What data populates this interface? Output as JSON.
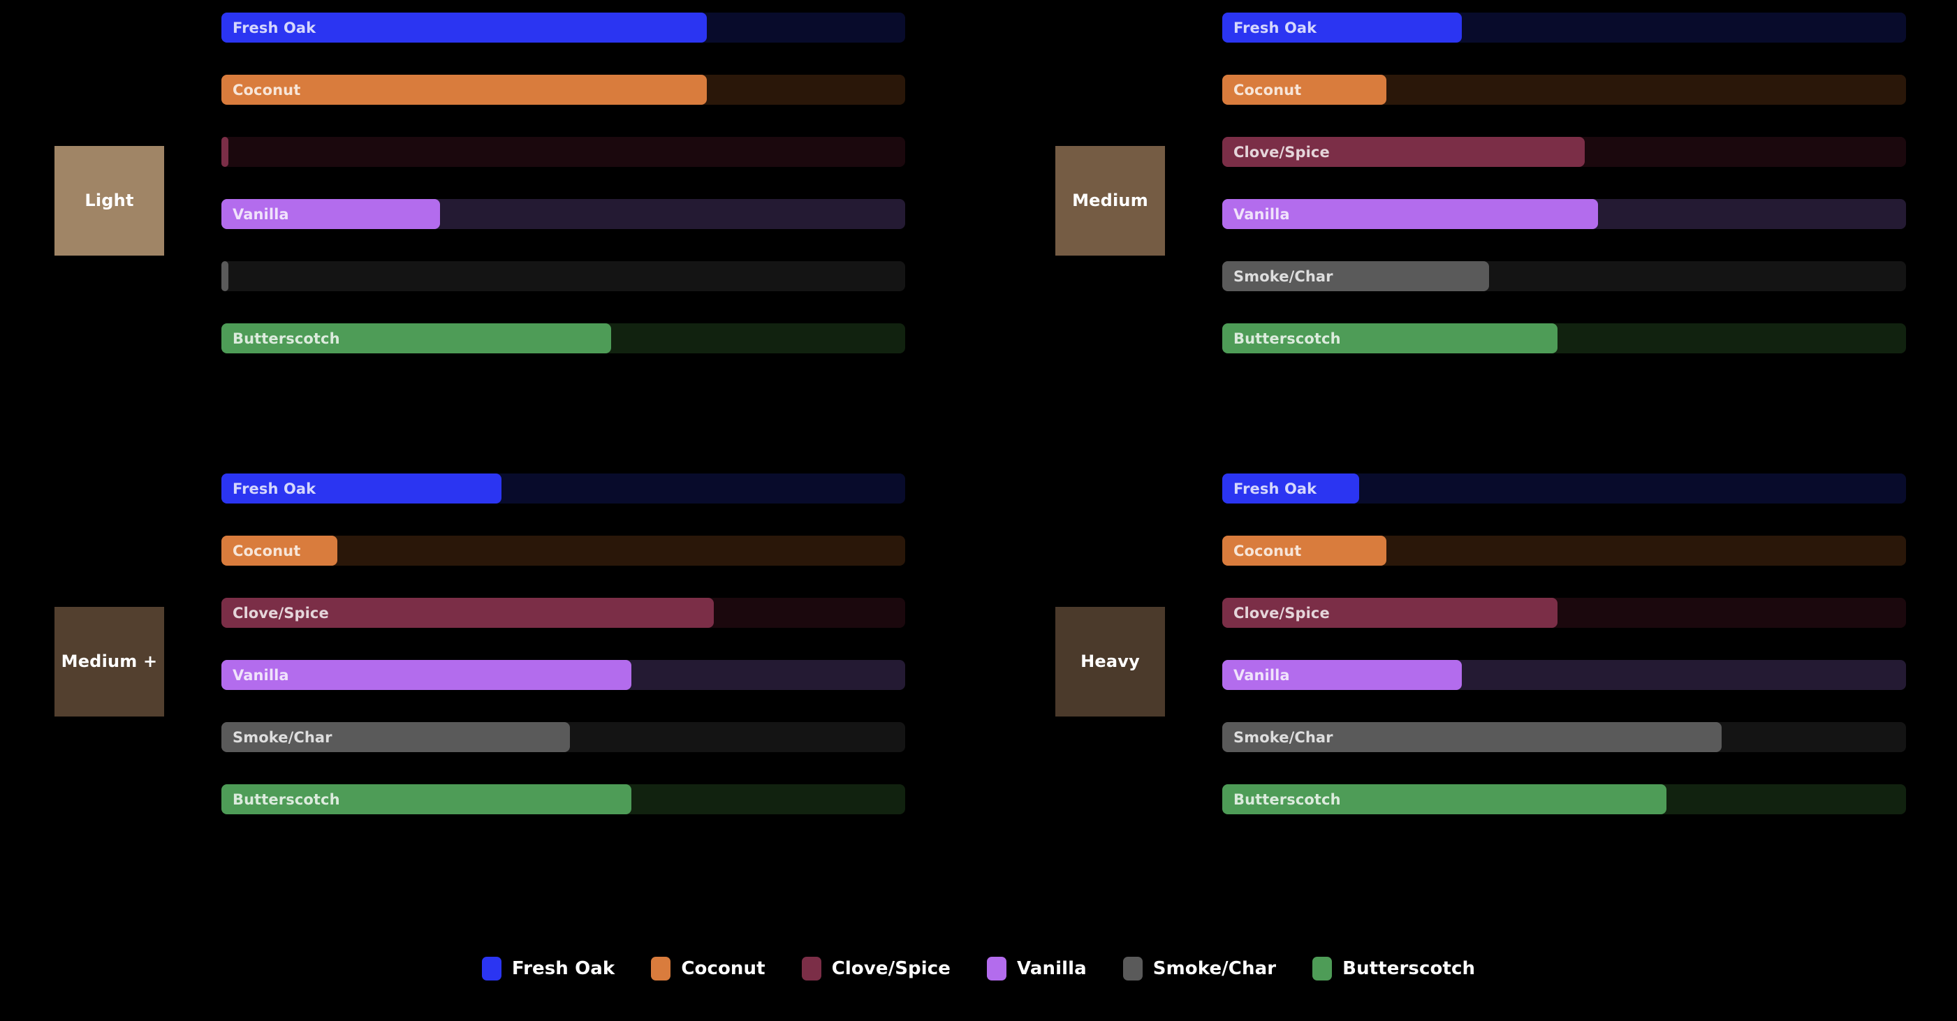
{
  "palette": {
    "background": "#000000",
    "fresh_oak": "#2b35f2",
    "coconut": "#d97c3d",
    "clove_spice": "#7b2e47",
    "vanilla": "#b36ced",
    "smoke_char": "#5a5a5a",
    "butterscotch": "#4e9c57",
    "track_fresh_oak": "#080b2b",
    "track_coconut": "#2a1709",
    "track_clove_spice": "#1b080d",
    "track_vanilla": "#241a33",
    "track_smoke_char": "#141414",
    "track_butterscotch": "#11220f"
  },
  "categories": [
    {
      "label": "Light",
      "color": "#a08566"
    },
    {
      "label": "Medium",
      "color": "#755c44"
    },
    {
      "label": "Medium +",
      "color": "#53402f"
    },
    {
      "label": "Heavy",
      "color": "#4b3a2b"
    }
  ],
  "legend": [
    {
      "label": "Fresh Oak",
      "color": "#2b35f2"
    },
    {
      "label": "Coconut",
      "color": "#d97c3d"
    },
    {
      "label": "Clove/Spice",
      "color": "#7b2e47"
    },
    {
      "label": "Vanilla",
      "color": "#b36ced"
    },
    {
      "label": "Smoke/Char",
      "color": "#5a5a5a"
    },
    {
      "label": "Butterscotch",
      "color": "#4e9c57"
    }
  ],
  "chart_data": {
    "type": "bar",
    "title": "",
    "xlabel": "",
    "ylabel": "",
    "xlim": [
      0,
      100
    ],
    "grid": false,
    "legend_position": "bottom",
    "orientation": "horizontal",
    "layout": "2x2 small multiples, shared 0-100 track",
    "categories": [
      "Light",
      "Medium",
      "Medium +",
      "Heavy"
    ],
    "attributes": [
      "Fresh Oak",
      "Coconut",
      "Clove/Spice",
      "Vanilla",
      "Smoke/Char",
      "Butterscotch"
    ],
    "panels": [
      {
        "category": "Light",
        "position": "top-left",
        "bars": [
          {
            "label": "Fresh Oak",
            "value": 71,
            "show_label": true,
            "color": "#2b35f2",
            "track": "#080b2b"
          },
          {
            "label": "Coconut",
            "value": 71,
            "show_label": true,
            "color": "#d97c3d",
            "track": "#2a1709"
          },
          {
            "label": "Clove/Spice",
            "value": 1,
            "show_label": false,
            "color": "#7b2e47",
            "track": "#1b080d"
          },
          {
            "label": "Vanilla",
            "value": 32,
            "show_label": true,
            "color": "#b36ced",
            "track": "#241a33"
          },
          {
            "label": "Smoke/Char",
            "value": 1,
            "show_label": false,
            "color": "#5a5a5a",
            "track": "#141414"
          },
          {
            "label": "Butterscotch",
            "value": 57,
            "show_label": true,
            "color": "#4e9c57",
            "track": "#11220f"
          }
        ]
      },
      {
        "category": "Medium",
        "position": "top-right",
        "bars": [
          {
            "label": "Fresh Oak",
            "value": 35,
            "show_label": true,
            "color": "#2b35f2",
            "track": "#080b2b"
          },
          {
            "label": "Coconut",
            "value": 24,
            "show_label": true,
            "color": "#d97c3d",
            "track": "#2a1709"
          },
          {
            "label": "Clove/Spice",
            "value": 53,
            "show_label": true,
            "color": "#7b2e47",
            "track": "#1b080d"
          },
          {
            "label": "Vanilla",
            "value": 55,
            "show_label": true,
            "color": "#b36ced",
            "track": "#241a33"
          },
          {
            "label": "Smoke/Char",
            "value": 39,
            "show_label": true,
            "color": "#5a5a5a",
            "track": "#141414"
          },
          {
            "label": "Butterscotch",
            "value": 49,
            "show_label": true,
            "color": "#4e9c57",
            "track": "#11220f"
          }
        ]
      },
      {
        "category": "Medium +",
        "position": "bottom-left",
        "bars": [
          {
            "label": "Fresh Oak",
            "value": 41,
            "show_label": true,
            "color": "#2b35f2",
            "track": "#080b2b"
          },
          {
            "label": "Coconut",
            "value": 17,
            "show_label": true,
            "color": "#d97c3d",
            "track": "#2a1709"
          },
          {
            "label": "Clove/Spice",
            "value": 72,
            "show_label": true,
            "color": "#7b2e47",
            "track": "#1b080d"
          },
          {
            "label": "Vanilla",
            "value": 60,
            "show_label": true,
            "color": "#b36ced",
            "track": "#241a33"
          },
          {
            "label": "Smoke/Char",
            "value": 51,
            "show_label": true,
            "color": "#5a5a5a",
            "track": "#141414"
          },
          {
            "label": "Butterscotch",
            "value": 60,
            "show_label": true,
            "color": "#4e9c57",
            "track": "#11220f"
          }
        ]
      },
      {
        "category": "Heavy",
        "position": "bottom-right",
        "bars": [
          {
            "label": "Fresh Oak",
            "value": 20,
            "show_label": true,
            "color": "#2b35f2",
            "track": "#080b2b"
          },
          {
            "label": "Coconut",
            "value": 24,
            "show_label": true,
            "color": "#d97c3d",
            "track": "#2a1709"
          },
          {
            "label": "Clove/Spice",
            "value": 49,
            "show_label": true,
            "color": "#7b2e47",
            "track": "#1b080d"
          },
          {
            "label": "Vanilla",
            "value": 35,
            "show_label": true,
            "color": "#b36ced",
            "track": "#241a33"
          },
          {
            "label": "Smoke/Char",
            "value": 73,
            "show_label": true,
            "color": "#5a5a5a",
            "track": "#141414"
          },
          {
            "label": "Butterscotch",
            "value": 65,
            "show_label": true,
            "color": "#4e9c57",
            "track": "#11220f"
          }
        ]
      }
    ]
  }
}
